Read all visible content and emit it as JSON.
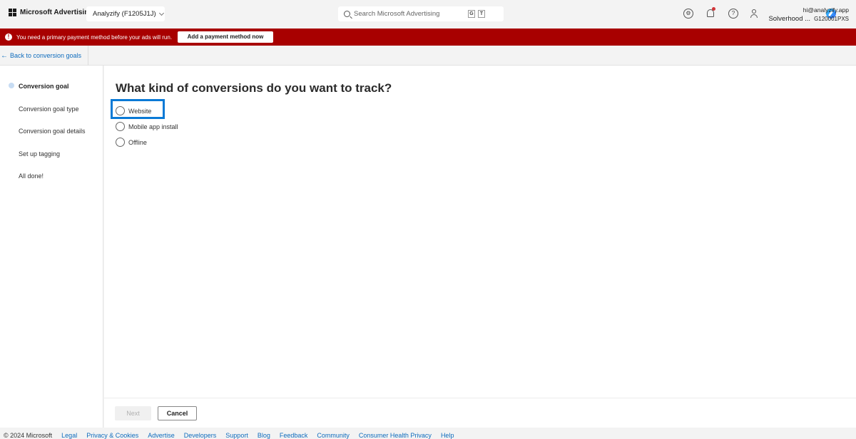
{
  "header": {
    "brand": "Microsoft Advertising",
    "account": "Analyzify (F1205J1J)",
    "search_placeholder": "Search Microsoft Advertising",
    "search_keys": [
      "G",
      "T"
    ],
    "user_email": "hi@analyzify.app",
    "user_org": "Solverhood ...",
    "customer_id": "G120001PXS"
  },
  "banner": {
    "message": "You need a primary payment method before your ads will run.",
    "button": "Add a payment method now",
    "color": "#a80000"
  },
  "back_link": "Back to conversion goals",
  "steps": [
    {
      "label": "Conversion goal",
      "active": true
    },
    {
      "label": "Conversion goal type",
      "active": false
    },
    {
      "label": "Conversion goal details",
      "active": false
    },
    {
      "label": "Set up tagging",
      "active": false
    },
    {
      "label": "All done!",
      "active": false
    }
  ],
  "main": {
    "title": "What kind of conversions do you want to track?",
    "options": [
      "Website",
      "Mobile app install",
      "Offline"
    ]
  },
  "actions": {
    "next": "Next",
    "cancel": "Cancel"
  },
  "footer": {
    "copyright": "© 2024 Microsoft",
    "links": [
      "Legal",
      "Privacy & Cookies",
      "Advertise",
      "Developers",
      "Support",
      "Blog",
      "Feedback",
      "Community",
      "Consumer Health Privacy",
      "Help"
    ]
  }
}
